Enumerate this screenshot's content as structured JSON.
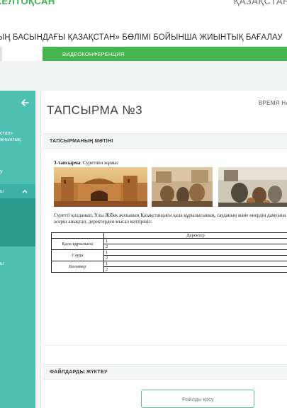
{
  "header": {
    "brand": "КЕЛТОҚСАН",
    "language": "ҚАЗАҚСТАН"
  },
  "subtitle": "ЫҢ БАСЫНДАҒЫ ҚАЗАҚСТАН» БӨЛІМІ БОЙЫНША ЖИЫНТЫҚ БАҒАЛАУ",
  "tabs": {
    "video_conference": "ВИДЕОКОНФЕРЕНЦИЯ"
  },
  "sidebar": {
    "item_1_line1": "стан»",
    "item_1_line2": "жиынтық",
    "item_2": "у",
    "item_3": "ы",
    "item_4": "ы"
  },
  "task": {
    "title": "ТАПСЫРМА №3",
    "time_label": "ВРЕМЯ НА",
    "text_section": "ТАПСЫРМАНЫҢ МӘТІНІ",
    "upload_section": "ФАЙЛДАРДЫ ЖҮКТЕУ",
    "upload_button": "Файлды қосу"
  },
  "document": {
    "heading_bold": "3-тапсырма",
    "heading_rest": ". Суретпен жұмыс",
    "prompt": "Суретті қолданып, Ұлы Жібек жолының Қазақстандағы қала құрылысының, сауданың және өнердің дамуына әсерін анықтап, деректерден мысал келтіріңіз:",
    "table_header": "Деректер",
    "rows": [
      {
        "category": "Қала құрылысы",
        "items": [
          "1",
          "2"
        ]
      },
      {
        "category": "Сауда",
        "items": [
          "1",
          "2"
        ]
      },
      {
        "category": "Көлөнер",
        "items": [
          "1",
          "2"
        ]
      }
    ]
  },
  "colors": {
    "brand_green": "#3bb54a",
    "tab_green": "#45b64f",
    "sidebar_teal": "#4fbfb4"
  }
}
